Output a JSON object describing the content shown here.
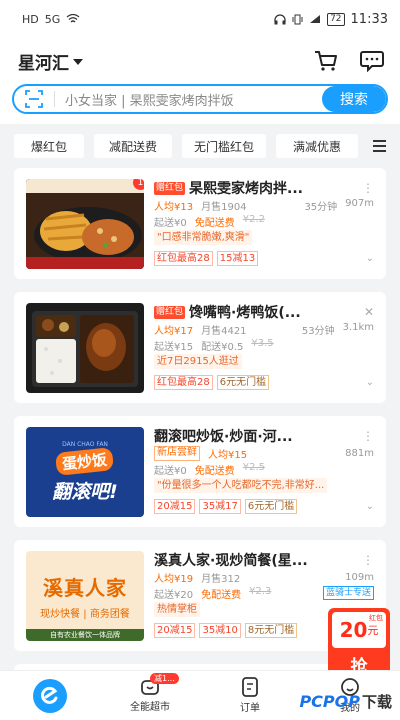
{
  "status_bar": {
    "left": "HD",
    "network": "5G",
    "battery": "72",
    "time": "11:33"
  },
  "header": {
    "location": "星河汇"
  },
  "search": {
    "placeholder": "小女当家 | 杲熙雯家烤肉拌饭",
    "button": "搜索"
  },
  "filters": [
    "爆红包",
    "减配送费",
    "无门槛红包",
    "满减优惠"
  ],
  "colors": {
    "accent": "#1a9fff",
    "orange": "#ff6a00",
    "red": "#ff3b30"
  },
  "stores": [
    {
      "ad": "赠红包",
      "name": "杲熙雯家烤肉拌...",
      "per_capita": "人均¥13",
      "monthly_sales": "月售1904",
      "time": "35分钟",
      "distance": "907m",
      "min_order": "起送¥0",
      "delivery": "免配送费",
      "delivery_orig": "¥2.2",
      "quote": "\"口感非常脆嫩,爽滑\"",
      "promos": [
        "红包最高28",
        "15减13"
      ],
      "badge": "1"
    },
    {
      "ad": "赠红包",
      "name": "馋嘴鸭·烤鸭饭(...",
      "per_capita": "人均¥17",
      "monthly_sales": "月售4421",
      "time": "53分钟",
      "distance": "3.1km",
      "min_order": "起送¥15",
      "delivery": "配送¥0.5",
      "delivery_orig": "¥3.5",
      "quote": "近7日2915人逛过",
      "promos": [
        "红包最高28",
        "6元无门槛"
      ]
    },
    {
      "ad": "",
      "name": "翻滚吧炒饭·炒面·河...",
      "new_tag": "新店尝鲜",
      "per_capita": "人均¥15",
      "monthly_sales": "",
      "time": "",
      "distance": "881m",
      "min_order": "起送¥0",
      "delivery": "免配送费",
      "delivery_orig": "¥2.5",
      "quote": "\"份量很多一个人吃都吃不完,非常好...",
      "promos": [
        "20减15",
        "35减17",
        "6元无门槛"
      ],
      "thumb_text": {
        "top": "DAN CHAO FAN",
        "main": "蛋炒饭",
        "sub": "翻滚吧!"
      }
    },
    {
      "ad": "",
      "name": "溪真人家·现炒简餐(星...",
      "per_capita": "人均¥19",
      "monthly_sales": "月售312",
      "time": "",
      "distance": "109m",
      "min_order": "起送¥20",
      "delivery": "免配送费",
      "delivery_orig": "¥2.3",
      "rider": "蓝骑士专送",
      "quote": "热情掌柜",
      "promos": [
        "20减15",
        "35减10",
        "8元无门槛"
      ],
      "thumb_text": {
        "main": "溪真人家",
        "sub": "现炒快餐 | 商务团餐",
        "foot": "自有农业餐饮一体品牌"
      }
    }
  ],
  "red_packet": {
    "label": "红包",
    "amount": "20",
    "unit": "元",
    "button": "抢"
  },
  "tabs": [
    {
      "label": ""
    },
    {
      "label": "全能超市",
      "badge": "减1..."
    },
    {
      "label": "订单"
    },
    {
      "label": "我的"
    }
  ],
  "watermark": {
    "pc": "PCPOP",
    "dl": "下载"
  }
}
